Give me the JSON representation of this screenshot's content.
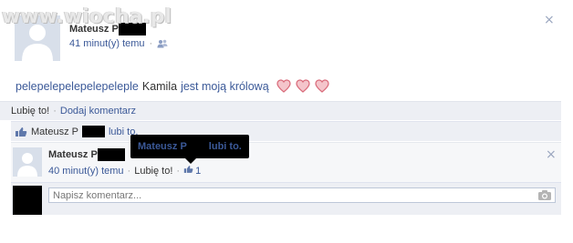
{
  "watermark": "www.wiocha.pl",
  "post": {
    "author": "Mateusz P",
    "time": "41 minut(y) temu",
    "separator": "·",
    "message_parts": {
      "link1": "pelepelepelepelepeleple",
      "name": "Kamila",
      "link2": "jest moją królową"
    },
    "close_symbol": "×"
  },
  "actions": {
    "like": "Lubię to!",
    "dot": "·",
    "comment": "Dodaj komentarz"
  },
  "likes": {
    "name": "Mateusz P",
    "action": "lubi to."
  },
  "comment": {
    "author": "Mateusz P",
    "time": "40 minut(y) temu",
    "dot": "·",
    "like": "Lubię to!",
    "dot2": "·",
    "count": "1",
    "close_symbol": "×"
  },
  "tooltip": {
    "name": "Mateusz P",
    "action": "lubi to."
  },
  "write": {
    "placeholder": "Napisz komentarz..."
  },
  "colors": {
    "link": "#3b5998",
    "bar": "#edeff4",
    "heart": "#e07a86"
  }
}
